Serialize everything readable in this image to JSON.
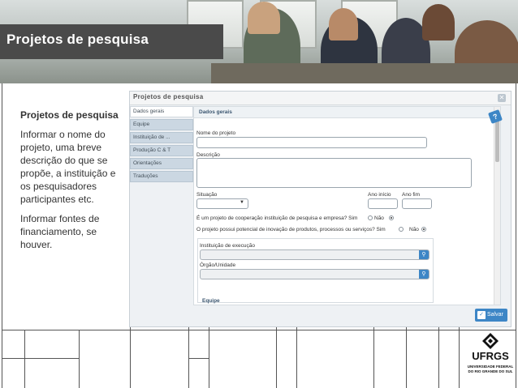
{
  "slide": {
    "title": "Projetos de pesquisa",
    "explanation": {
      "heading": "Projetos de pesquisa",
      "paragraph1": "Informar o nome do projeto, uma breve descrição do que se propõe, a instituição e os pesquisadores participantes etc.",
      "paragraph2": "Informar fontes de financiamento, se houver."
    }
  },
  "app": {
    "window_title": "Projetos de pesquisa",
    "close_icon": "close-icon",
    "tabs": [
      {
        "label": "Dados gerais",
        "active": true
      },
      {
        "label": "Equipe",
        "active": false
      },
      {
        "label": "Instituição de ...",
        "active": false
      },
      {
        "label": "Produção C & T",
        "active": false
      },
      {
        "label": "Orientações",
        "active": false
      },
      {
        "label": "Traduções",
        "active": false
      }
    ],
    "form": {
      "section_title": "Dados gerais",
      "nome_label": "Nome do projeto",
      "nome_value": "",
      "descricao_label": "Descrição",
      "descricao_value": "",
      "situacao_label": "Situação",
      "situacao_value": "",
      "ano_inicio_label": "Ano início",
      "ano_fim_label": "Ano fim",
      "q1": "É um projeto de cooperação instituição de pesquisa e empresa? Sim",
      "q1_no": "Não",
      "q2": "O projeto possui potencial de inovação de produtos, processos ou serviços? Sim",
      "q2_no": "Não",
      "instituicao_label": "Instituição de execução",
      "orgao_label": "Órgão/Unidade",
      "equipe_label": "Equipe",
      "search_icon": "search-icon"
    },
    "save_label": "Salvar"
  },
  "logo": {
    "name": "UFRGS",
    "subtitle": "UNIVERSIDADE FEDERAL DO RIO GRANDE DO SUL"
  },
  "colors": {
    "title_bar": "#4a4a4a",
    "accent_blue": "#3d86c6",
    "tab_bg": "#cbd7e2"
  }
}
